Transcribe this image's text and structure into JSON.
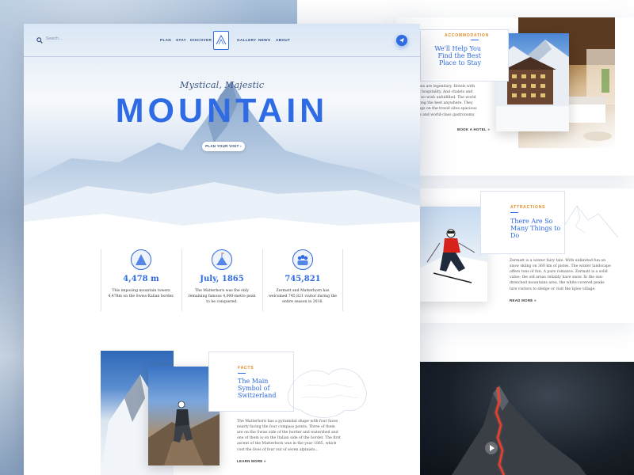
{
  "header": {
    "search_placeholder": "Search...",
    "nav": [
      "PLAN",
      "STAY",
      "DISCOVER",
      "GALLERY",
      "NEWS",
      "ABOUT"
    ]
  },
  "hero": {
    "subtitle": "Mystical, Majestic",
    "title": "MOUNTAIN",
    "cta": "PLAN YOUR VISIT"
  },
  "stats": [
    {
      "icon": "mountain-icon",
      "value": "4,478 m",
      "desc": "This imposing mountain towers 4,478m on the Swiss-Italian border."
    },
    {
      "icon": "flag-summit-icon",
      "value": "July, 1865",
      "desc": "The Matterhorn was the only remaining famous 4,000-metre peak to be conquered."
    },
    {
      "icon": "visitors-icon",
      "value": "745,821",
      "desc": "Zermatt and Matterhorn has welcomed 745,821 visitor during the entire season in 2016."
    }
  ],
  "facts": {
    "eyebrow": "FACTS",
    "title": "The Main Symbol of Switzerland",
    "text": "The Matterhorn has a pyramidal shape with four faces nearly facing the four compass points. Three of them are on the Swiss side of the border and watershed and one of them is on the Italian side of the border. The first ascent of the Matterhorn was in the year 1865, which cost the lives of four out of seven alpinists...",
    "link": "LEARN MORE"
  },
  "accommodation": {
    "eyebrow": "ACCOMMODATION",
    "title": "We'll Help You Find the Best Place to Stay",
    "text": "ations are legendary. Hotels with and hospitality. And chalets and are no wish unfulfilled. The world among the best anywhere. They things on the travel sites spacious ings and world-class gastronomy.",
    "link": "BOOK A HOTEL"
  },
  "attractions": {
    "eyebrow": "ATTRACTIONS",
    "title": "There Are So Many Things to Do",
    "text": "Zermatt is a winter fairy tale. With unlimited fun on snow skiing on 360 km of pistes. The winter landscape offers tons of fun. A pure romance. Zermatt is a solid value; the old areas reliably have snow. In the sun-drenched mountains area, the white-covered peaks lure visitors to sledge or visit the Igloo village.",
    "link": "READ MORE"
  },
  "colors": {
    "accent": "#2e6ae0",
    "eyebrow": "#e58b2a",
    "nav_text": "#2b4a7a"
  }
}
